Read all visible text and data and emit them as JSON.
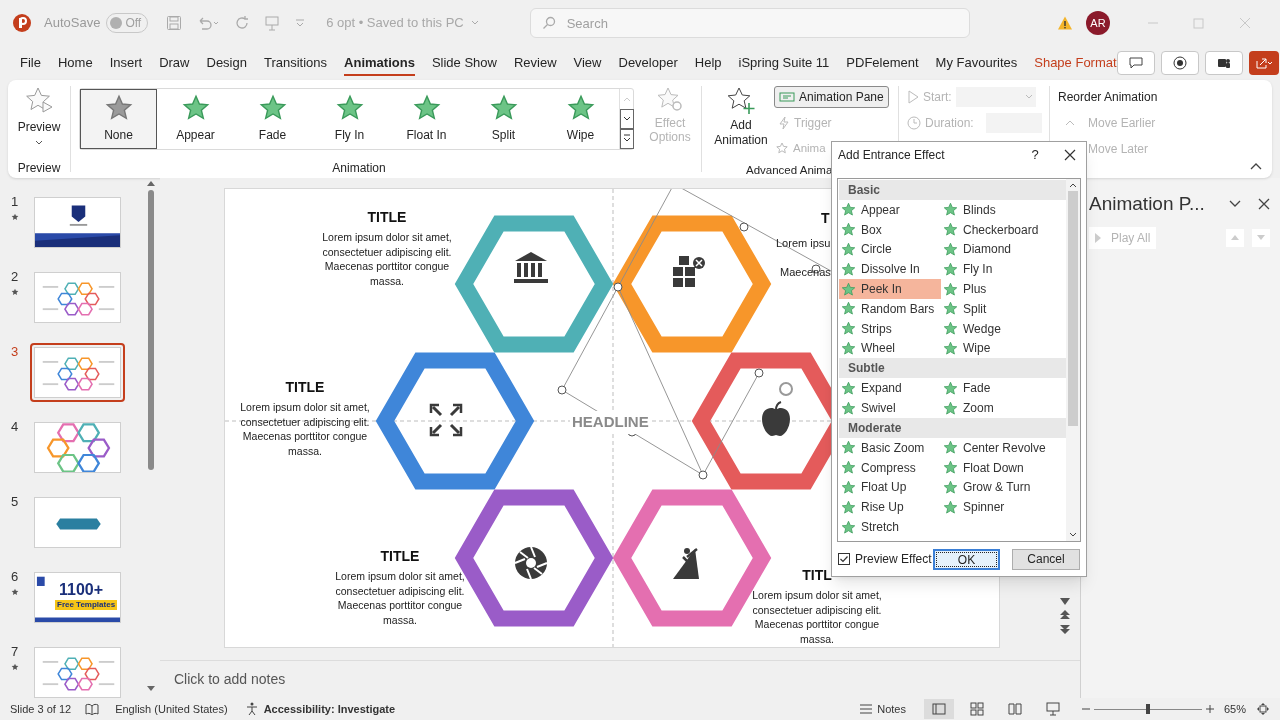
{
  "title_bar": {
    "autosave_label": "AutoSave",
    "autosave": {
      "on": false,
      "label": "Off"
    },
    "document": "6 opt  •  Saved to this PC",
    "search": {
      "placeholder": "Search"
    },
    "avatar": "AR"
  },
  "menu_tabs": [
    {
      "label": "File",
      "selected": false,
      "kind": "normal"
    },
    {
      "label": "Home",
      "selected": false,
      "kind": "normal"
    },
    {
      "label": "Insert",
      "selected": false,
      "kind": "normal"
    },
    {
      "label": "Draw",
      "selected": false,
      "kind": "normal"
    },
    {
      "label": "Design",
      "selected": false,
      "kind": "normal"
    },
    {
      "label": "Transitions",
      "selected": false,
      "kind": "normal"
    },
    {
      "label": "Animations",
      "selected": true,
      "kind": "normal"
    },
    {
      "label": "Slide Show",
      "selected": false,
      "kind": "normal"
    },
    {
      "label": "Review",
      "selected": false,
      "kind": "normal"
    },
    {
      "label": "View",
      "selected": false,
      "kind": "normal"
    },
    {
      "label": "Developer",
      "selected": false,
      "kind": "normal"
    },
    {
      "label": "Help",
      "selected": false,
      "kind": "normal"
    },
    {
      "label": "iSpring Suite 11",
      "selected": false,
      "kind": "normal"
    },
    {
      "label": "PDFelement",
      "selected": false,
      "kind": "normal"
    },
    {
      "label": "My Favourites",
      "selected": false,
      "kind": "normal"
    },
    {
      "label": "Shape Format",
      "selected": false,
      "kind": "contextual"
    }
  ],
  "ribbon": {
    "preview": {
      "label": "Preview",
      "group": "Preview"
    },
    "gallery": {
      "group": "Animation",
      "items": [
        {
          "label": "None",
          "selected": true
        },
        {
          "label": "Appear",
          "selected": false
        },
        {
          "label": "Fade",
          "selected": false
        },
        {
          "label": "Fly In",
          "selected": false
        },
        {
          "label": "Float In",
          "selected": false
        },
        {
          "label": "Split",
          "selected": false
        },
        {
          "label": "Wipe",
          "selected": false
        }
      ]
    },
    "effect_options": {
      "label": "Effect Options",
      "disabled": true
    },
    "add_animation": "Add Animation",
    "animation_pane": "Animation Pane",
    "trigger": {
      "label": "Trigger",
      "disabled": true
    },
    "animation_painter": {
      "label": "Anima",
      "disabled": true
    },
    "advanced_group": "Advanced Anima",
    "start": {
      "label": "Start:",
      "disabled": true
    },
    "duration": {
      "label": "Duration:",
      "disabled": true
    },
    "reorder_title": "Reorder Animation",
    "move_earlier": {
      "label": "Move Earlier",
      "disabled": true
    },
    "move_later": {
      "label": "Move Later",
      "disabled": true
    }
  },
  "thumbnails": [
    {
      "number": "1",
      "starred": true,
      "selected": false,
      "kind": "cover"
    },
    {
      "number": "2",
      "starred": true,
      "selected": false,
      "kind": "hex"
    },
    {
      "number": "3",
      "starred": false,
      "selected": true,
      "kind": "hex"
    },
    {
      "number": "4",
      "starred": false,
      "selected": false,
      "kind": "outline"
    },
    {
      "number": "5",
      "starred": false,
      "selected": false,
      "kind": "bar"
    },
    {
      "number": "6",
      "starred": true,
      "selected": false,
      "kind": "promo",
      "heading": "1100+",
      "subheading": "Free Templates"
    },
    {
      "number": "7",
      "starred": true,
      "selected": false,
      "kind": "hex"
    }
  ],
  "slide": {
    "headline": "HEADLINE",
    "blocks": [
      {
        "title": "TITLE",
        "text": "Lorem ipsum dolor sit amet, consectetuer adipiscing elit. Maecenas porttitor congue massa."
      },
      {
        "title": "TITLE",
        "text": "Lorem ipsum dolor sit amet, consectetuer adipiscing elit. Maecenas porttitor congue massa."
      },
      {
        "title": "TITLE",
        "text": "Lorem ipsum dolor sit amet, consectetuer adipiscing elit. Maecenas porttitor congue massa."
      },
      {
        "title": "TITL",
        "text": "Lorem ipsum dolor sit amet, consectetuer adipiscing elit. Maecenas porttitor congue massa."
      }
    ],
    "partial_block": {
      "title": "T",
      "lines": [
        "Lorem ipsu",
        "Maecenas"
      ]
    },
    "hexagons": [
      {
        "color": "#4fb0b5"
      },
      {
        "color": "#f7962a"
      },
      {
        "color": "#3f86d9"
      },
      {
        "color": "#e45b5b"
      },
      {
        "color": "#9a5cc8"
      },
      {
        "color": "#e46fb0"
      }
    ]
  },
  "notes": {
    "placeholder": "Click to add notes"
  },
  "animation_pane": {
    "title": "Animation P...",
    "play_all": {
      "label": "Play All",
      "disabled": true
    }
  },
  "dialog": {
    "title": "Add Entrance Effect",
    "help": "?",
    "sections": [
      {
        "name": "Basic",
        "items": [
          {
            "label": "Appear",
            "selected": false
          },
          {
            "label": "Blinds",
            "selected": false
          },
          {
            "label": "Box",
            "selected": false
          },
          {
            "label": "Checkerboard",
            "selected": false
          },
          {
            "label": "Circle",
            "selected": false
          },
          {
            "label": "Diamond",
            "selected": false
          },
          {
            "label": "Dissolve In",
            "selected": false
          },
          {
            "label": "Fly In",
            "selected": false
          },
          {
            "label": "Peek In",
            "selected": true
          },
          {
            "label": "Plus",
            "selected": false
          },
          {
            "label": "Random Bars",
            "selected": false
          },
          {
            "label": "Split",
            "selected": false
          },
          {
            "label": "Strips",
            "selected": false
          },
          {
            "label": "Wedge",
            "selected": false
          },
          {
            "label": "Wheel",
            "selected": false
          },
          {
            "label": "Wipe",
            "selected": false
          }
        ]
      },
      {
        "name": "Subtle",
        "items": [
          {
            "label": "Expand",
            "selected": false
          },
          {
            "label": "Fade",
            "selected": false
          },
          {
            "label": "Swivel",
            "selected": false
          },
          {
            "label": "Zoom",
            "selected": false
          }
        ]
      },
      {
        "name": "Moderate",
        "items": [
          {
            "label": "Basic Zoom",
            "selected": false
          },
          {
            "label": "Center Revolve",
            "selected": false
          },
          {
            "label": "Compress",
            "selected": false
          },
          {
            "label": "Float Down",
            "selected": false
          },
          {
            "label": "Float Up",
            "selected": false
          },
          {
            "label": "Grow & Turn",
            "selected": false
          },
          {
            "label": "Rise Up",
            "selected": false
          },
          {
            "label": "Spinner",
            "selected": false
          },
          {
            "label": "Stretch",
            "selected": false
          }
        ]
      }
    ],
    "preview": {
      "label": "Preview Effect",
      "checked": true
    },
    "ok": "OK",
    "cancel": "Cancel"
  },
  "status_bar": {
    "slide": "Slide 3 of 12",
    "language": "English (United States)",
    "accessibility": "Accessibility: Investigate",
    "notes": "Notes",
    "views": [
      {
        "kind": "normal",
        "selected": true
      },
      {
        "kind": "sorter",
        "selected": false
      },
      {
        "kind": "reading",
        "selected": false
      },
      {
        "kind": "show",
        "selected": false
      }
    ],
    "zoom": {
      "level": 0.5,
      "reading": "65%"
    }
  }
}
